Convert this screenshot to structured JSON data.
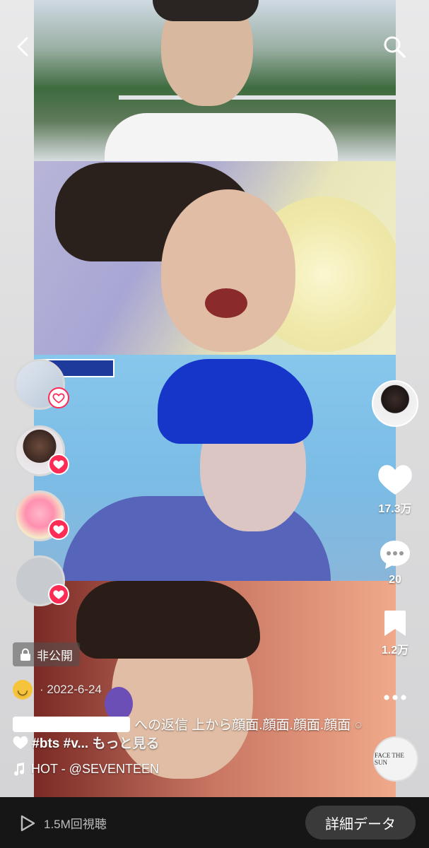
{
  "header": {
    "back_icon": "chevron-left-icon",
    "search_icon": "search-icon"
  },
  "left_avatars": [
    {
      "badge": "heart-outline"
    },
    {
      "badge": "heart"
    },
    {
      "badge": "heart"
    },
    {
      "badge": "heart"
    }
  ],
  "right_rail": {
    "likes": "17.3万",
    "comments": "20",
    "saves": "1.2万"
  },
  "post": {
    "privacy_label": "非公開",
    "date": "· 2022-6-24",
    "caption_prefix": "への返信 上から顔面.顔面.顔面.顔面",
    "hashtags": "#bts #v...",
    "more": "もっと見る",
    "music": "HOT - @SEVENTEEN",
    "disc_label": "FACE THE SUN"
  },
  "bottom_bar": {
    "views": "1.5M回視聴",
    "detail_button": "詳細データ"
  },
  "colors": {
    "accent": "#fe2c55",
    "bar": "#161616",
    "button": "#3a3a3a"
  }
}
